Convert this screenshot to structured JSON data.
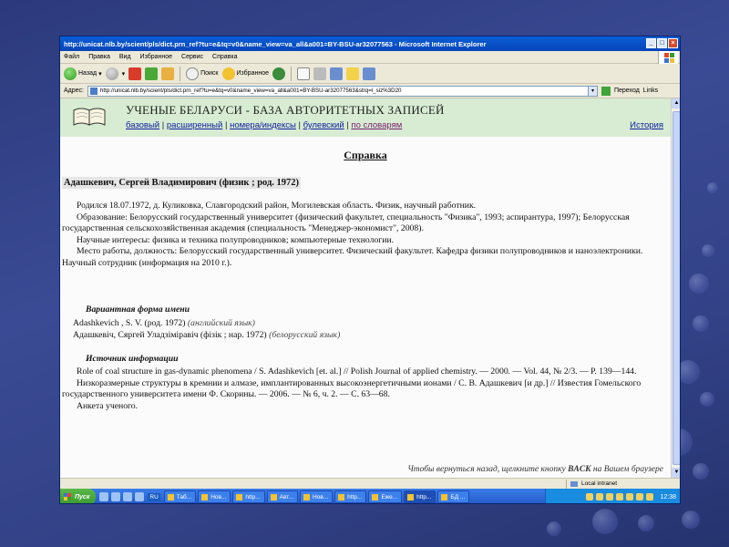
{
  "window": {
    "title": "http://unicat.nlb.by/scient/pls/dict.prn_ref?tu=e&tq=v0&name_view=va_all&a001=BY-BSU-ar32077563 - Microsoft Internet Explorer"
  },
  "menu": [
    "Файл",
    "Правка",
    "Вид",
    "Избранное",
    "Сервис",
    "Справка"
  ],
  "toolbar": {
    "back": "Назад",
    "search": "Поиск",
    "favorites": "Избранное"
  },
  "address": {
    "label": "Адрес:",
    "url": "http://unicat.nlb.by/scient/pls/dict.prn_ref?tu=e&tq=v0&name_view=va_all&a001=BY-BSU-ar32077563&strq=l_siz%3D20",
    "go": "Переход",
    "links": "Links"
  },
  "site": {
    "title": "УЧЕНЫЕ БЕЛАРУСИ - БАЗА АВТОРИТЕТНЫХ ЗАПИСЕЙ",
    "nav": [
      "базовый",
      "расширенный",
      "номера/индексы",
      "булевский",
      "по словарям"
    ],
    "history": "История"
  },
  "doc": {
    "title": "Справка",
    "name": "Адашкевич, Сергей Владимирович (физик ; род. 1972)",
    "paragraphs": [
      "Родился 18.07.1972, д. Куликовка, Славгородский район, Могилевская область. Физик, научный работник.",
      "Образование: Белорусский государственный университет (физический факультет, специальность \"Физика\", 1993; аспирантура, 1997); Белорусская государственная сельскохозяйственная академия (специальность \"Менеджер-экономист\", 2008).",
      "Научные интересы: физика и техника полупроводников; компьютерные технологии.",
      "Место работы, должность: Белорусский государственный университет. Физический факультет. Кафедра физики полупроводников и наноэлектроники. Научный сотрудник (информация на 2010 г.)."
    ],
    "variant_heading": "Вариантная форма имени",
    "variants": [
      {
        "name": "Adashkevich , S. V. (род. 1972)",
        "lang": "(английский язык)"
      },
      {
        "name": "Адашкевіч, Сяргей Уладзіміравіч (фізік ; нар. 1972)",
        "lang": "(белорусский язык)"
      }
    ],
    "source_heading": "Источник информации",
    "sources": [
      "Role of coal structure in gas-dynamic phenomena / S. Adashkevich [et. al.] // Polish Journal of applied chemistry. — 2000. — Vol. 44, № 2/3. — P. 139—144.",
      "Низкоразмерные структуры в кремнии и алмазе, имплантированных высокоэнергетичными ионами / С. В. Адашкевич [и др.] // Известия Гомельского государственного университета имени Ф. Скорины. — 2006. — № 6, ч. 2. — С. 63—68.",
      "Анкета ученого."
    ],
    "back_note_before": "Чтобы вернуться назад, щелкните кнопку",
    "back_note_key": "BACK",
    "back_note_after": "на Вашем браузере"
  },
  "status": {
    "zone": "Local intranet"
  },
  "taskbar": {
    "start": "Пуск",
    "lang": "RU",
    "tasks": [
      "Таб...",
      "Нов...",
      "http...",
      "Авт...",
      "Нов...",
      "http...",
      "Еже...",
      "http...",
      "БД ..."
    ],
    "clock": "12:38"
  }
}
